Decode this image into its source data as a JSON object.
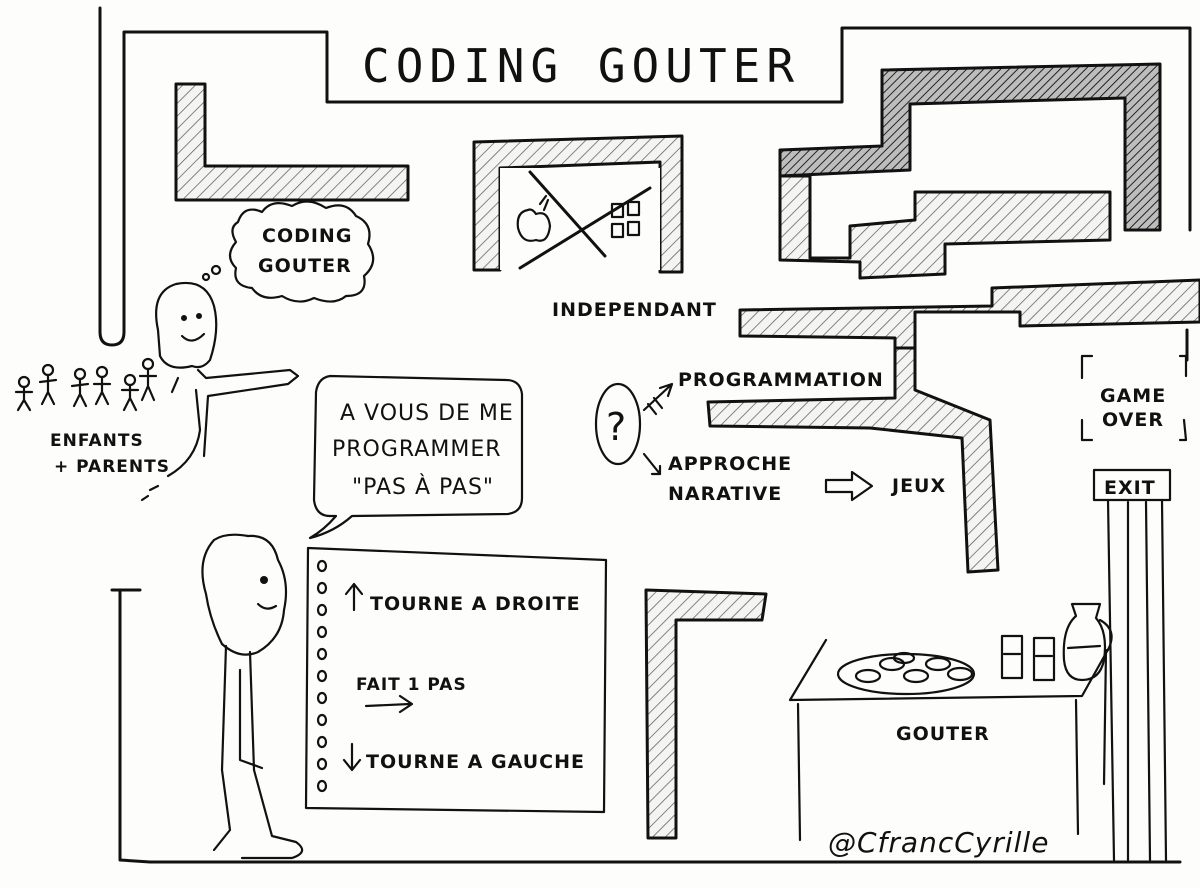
{
  "title": "CODING GOUTER",
  "thought_bubble": [
    "CODING",
    "GOUTER"
  ],
  "audience_label": [
    "ENFANTS",
    "+ PARENTS"
  ],
  "speech_bubble": [
    "A VOUS DE ME",
    "PROGRAMMER",
    "\"PAS À PAS\""
  ],
  "independant_label": "INDEPENDANT",
  "question_mark": "?",
  "programmation_label": "PROGRAMMATION",
  "approche_label": [
    "APPROCHE",
    "NARATIVE"
  ],
  "jeux_label": "JEUX",
  "game_over_label": [
    "GAME",
    "OVER"
  ],
  "exit_label": "EXIT",
  "instructions": {
    "turn_right": "TOURNE A DROITE",
    "step": "FAIT 1 PAS",
    "turn_left": "TOURNE A GAUCHE"
  },
  "gouter_label": "GOUTER",
  "signature": "@CfrancCyrille",
  "icons": [
    "apple-logo-icon",
    "windows-logo-icon",
    "cross-out-icon",
    "arrow-icon"
  ],
  "colors": {
    "ink": "#111111",
    "paper": "#fdfdfb"
  }
}
